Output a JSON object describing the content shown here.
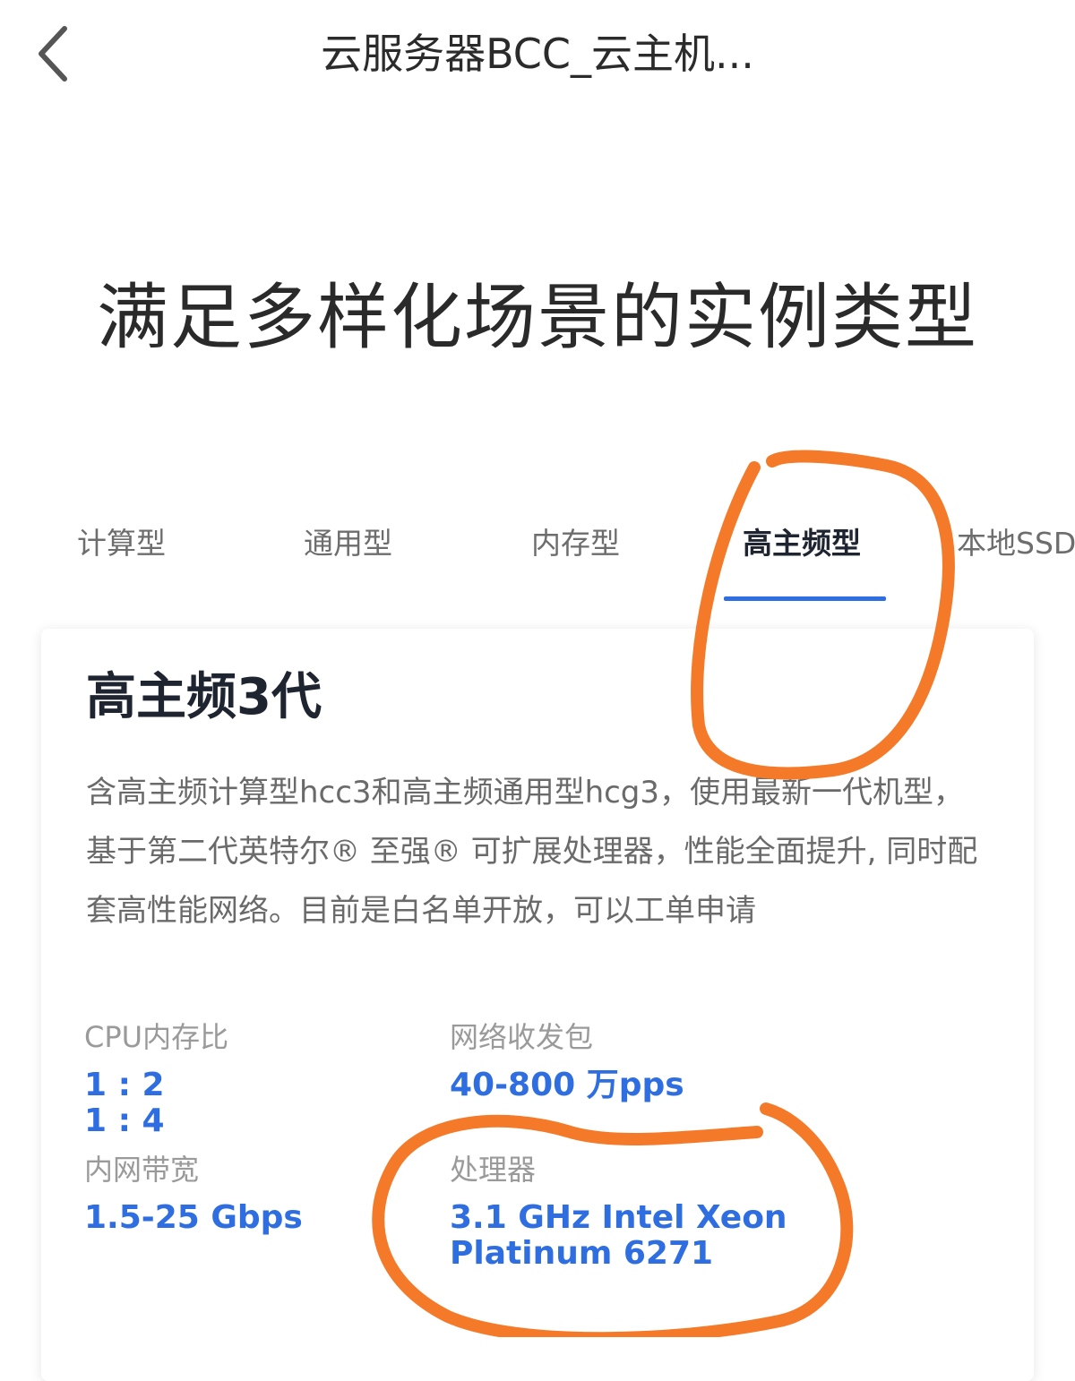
{
  "header": {
    "back_icon": "chevron-left-icon",
    "title": "云服务器BCC_云主机..."
  },
  "hero": {
    "heading": "满足多样化场景的实例类型"
  },
  "tabs": {
    "items": [
      {
        "label": "计算型",
        "active": false
      },
      {
        "label": "通用型",
        "active": false
      },
      {
        "label": "内存型",
        "active": false
      },
      {
        "label": "高主频型",
        "active": true
      },
      {
        "label": "本地SSD",
        "active": false
      }
    ],
    "accent_color": "#2f6ee0"
  },
  "card": {
    "title": "高主频3代",
    "description": "含高主频计算型hcc3和高主频通用型hcg3，使用最新一代机型，基于第二代英特尔® 至强® 可扩展处理器，性能全面提升, 同时配套高性能网络。目前是白名单开放，可以工单申请",
    "specs": {
      "cpu_memory_ratio": {
        "label": "CPU内存比",
        "values": [
          "1 : 2",
          "1 : 4"
        ]
      },
      "network_pps": {
        "label": "网络收发包",
        "value": "40-800 万pps"
      },
      "intranet_bandwidth": {
        "label": "内网带宽",
        "value": "1.5-25 Gbps"
      },
      "processor": {
        "label": "处理器",
        "values": [
          "3.1 GHz Intel Xeon",
          "Platinum 6271"
        ]
      }
    }
  },
  "annotation": {
    "color": "#f47a2a"
  }
}
